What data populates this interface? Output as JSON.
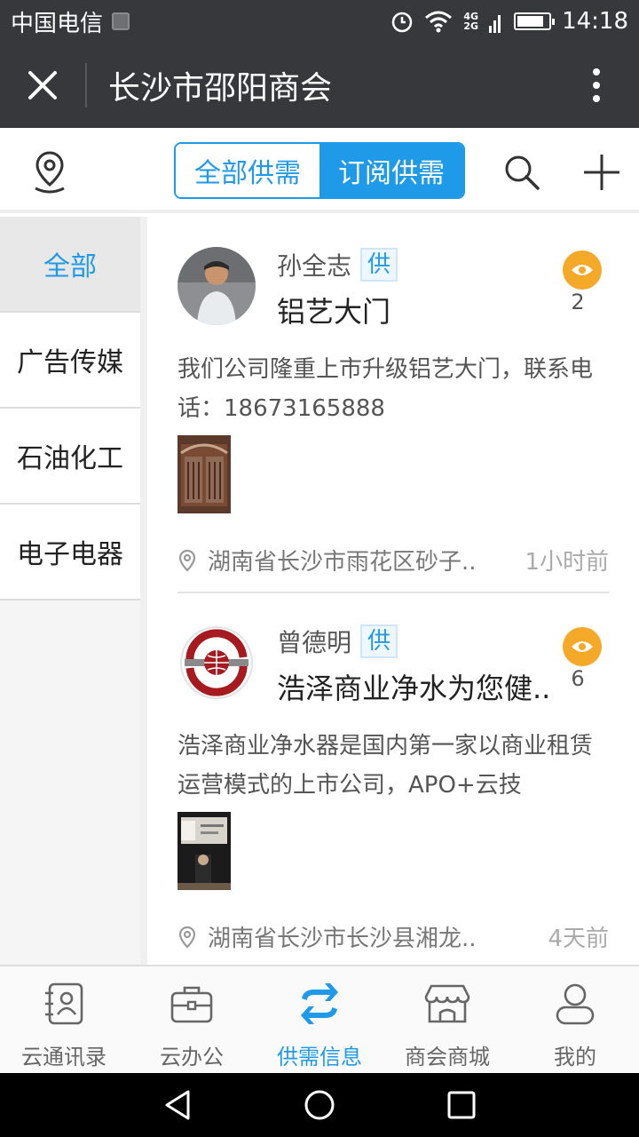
{
  "status_bar": {
    "carrier": "中国电信",
    "network": [
      "4G",
      "2G"
    ],
    "time": "14:18",
    "battery_level": 0.85
  },
  "header": {
    "title": "长沙市邵阳商会",
    "close_icon": "close-icon",
    "more_icon": "more-vertical-icon"
  },
  "filter": {
    "tabs": [
      {
        "label": "全部供需",
        "active": false
      },
      {
        "label": "订阅供需",
        "active": true
      }
    ],
    "accent": "#1e9ae8"
  },
  "sidebar": {
    "items": [
      {
        "label": "全部",
        "active": true
      },
      {
        "label": "广告传媒",
        "active": false
      },
      {
        "label": "石油化工",
        "active": false
      },
      {
        "label": "电子电器",
        "active": false
      }
    ]
  },
  "posts": [
    {
      "author": "孙全志",
      "tag": "供",
      "title": "铝艺大门",
      "views": "2",
      "description": "我们公司隆重上市升级铝艺大门，联系电话：18673165888",
      "location": "湖南省长沙市雨花区砂子..",
      "time": "1小时前"
    },
    {
      "author": "曾德明",
      "tag": "供",
      "title": "浩泽商业净水为您健..",
      "views": "6",
      "description": "浩泽商业净水器是国内第一家以商业租赁运营模式的上市公司，APO+云技",
      "location": "湖南省长沙市长沙县湘龙..",
      "time": "4天前"
    }
  ],
  "bottom_nav": {
    "items": [
      {
        "label": "云通讯录",
        "icon": "contacts-icon",
        "active": false
      },
      {
        "label": "云办公",
        "icon": "briefcase-icon",
        "active": false
      },
      {
        "label": "供需信息",
        "icon": "exchange-icon",
        "active": true
      },
      {
        "label": "商会商城",
        "icon": "store-icon",
        "active": false
      },
      {
        "label": "我的",
        "icon": "user-icon",
        "active": false
      }
    ]
  },
  "colors": {
    "header_bg": "#37383c",
    "accent": "#1e9ae8",
    "eye_badge": "#f4a928"
  }
}
